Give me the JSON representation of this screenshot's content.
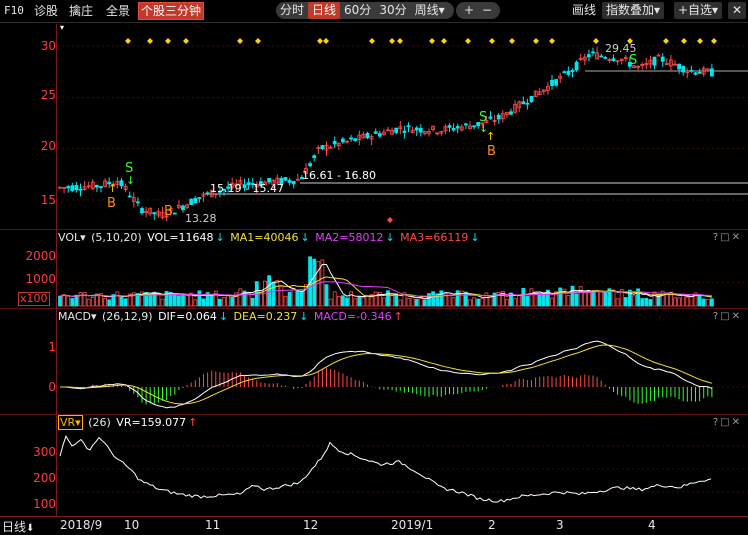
{
  "toolbar": {
    "f10": "F10",
    "diagnose": "诊股",
    "pick": "擒庄",
    "panorama": "全景",
    "active_tab": "个股三分钟",
    "periods": [
      "分时",
      "日线",
      "60分",
      "30分",
      "周线▾"
    ],
    "selected_period": "日线",
    "plus": "+",
    "minus": "−",
    "draw": "画线",
    "index_overlay": "指数叠加▾",
    "watchlist": "+自选▾",
    "close": "✕"
  },
  "price_axis": [
    "30",
    "25",
    "20",
    "15"
  ],
  "price_annotations": {
    "high": "29.45",
    "low": "13.28",
    "range1": "15.19 - 15.47",
    "range2": "16.61 - 16.80",
    "signals": [
      "S",
      "B",
      "B",
      "S",
      "B",
      "S"
    ]
  },
  "vol_panel": {
    "name": "VOL▾",
    "params": "(5,10,20)",
    "vol": "VOL=11648",
    "ma1": "MA1=40046",
    "ma2": "MA2=58012",
    "ma3": "MA3=66119",
    "axis": [
      "2000",
      "1000"
    ],
    "unit": "x100",
    "controls": "?□✕"
  },
  "macd_panel": {
    "name": "MACD▾",
    "params": "(26,12,9)",
    "dif": "DIF=0.064",
    "dea": "DEA=0.237",
    "macd": "MACD=-0.346",
    "axis": [
      "1",
      "0"
    ],
    "controls": "?□✕"
  },
  "vr_panel": {
    "name": "VR▾",
    "params": "(26)",
    "vr": "VR=159.077",
    "axis": [
      "300",
      "200",
      "100"
    ],
    "controls": "?□✕"
  },
  "xaxis": {
    "period_label": "日线",
    "labels": [
      "2018/9",
      "10",
      "11",
      "12",
      "2019/1",
      "2",
      "3",
      "4"
    ]
  },
  "colors": {
    "up": "#ff4a4a",
    "down": "#00e5ee",
    "ma1": "#ffffff",
    "ma2": "#f0e030",
    "ma3": "#e040fb",
    "signal_sell": "#33ff33",
    "signal_buy": "#ff8c00",
    "diamond": "#ffd200",
    "axis_text": "#ff3b3b"
  }
}
